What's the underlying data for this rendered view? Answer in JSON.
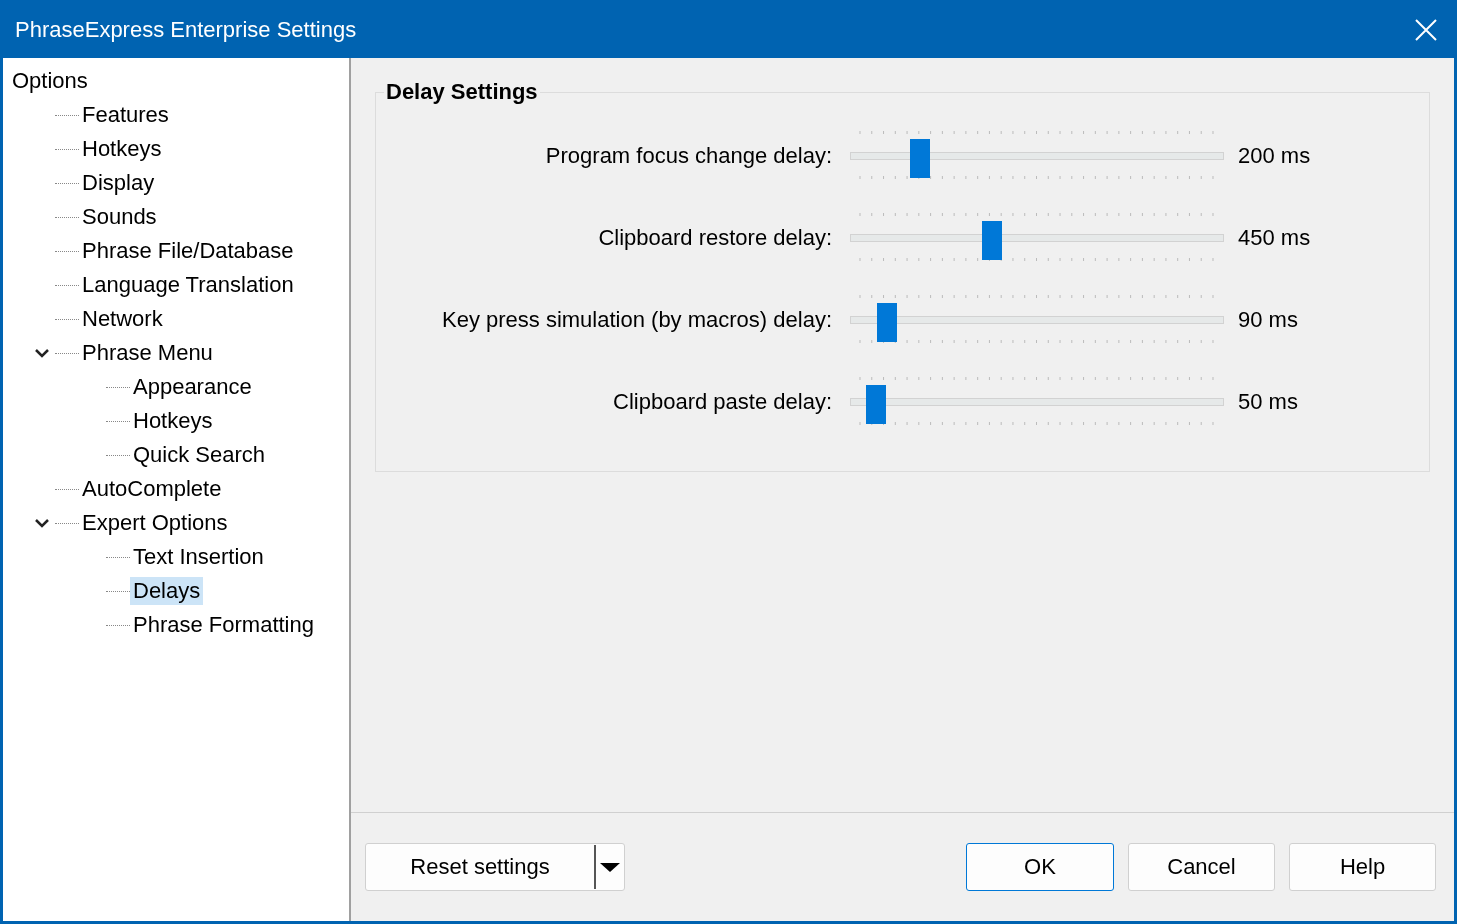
{
  "window": {
    "title": "PhraseExpress Enterprise Settings"
  },
  "tree": {
    "label": "Options",
    "children": [
      {
        "label": "Features",
        "selected": false
      },
      {
        "label": "Hotkeys",
        "selected": false
      },
      {
        "label": "Display",
        "selected": false
      },
      {
        "label": "Sounds",
        "selected": false
      },
      {
        "label": "Phrase File/Database",
        "selected": false
      },
      {
        "label": "Language Translation",
        "selected": false
      },
      {
        "label": "Network",
        "selected": false
      },
      {
        "label": "Phrase Menu",
        "selected": false,
        "expanded": true,
        "children": [
          {
            "label": "Appearance",
            "selected": false
          },
          {
            "label": "Hotkeys",
            "selected": false
          },
          {
            "label": "Quick Search",
            "selected": false
          }
        ]
      },
      {
        "label": "AutoComplete",
        "selected": false
      },
      {
        "label": "Expert Options",
        "selected": false,
        "expanded": true,
        "children": [
          {
            "label": "Text Insertion",
            "selected": false
          },
          {
            "label": "Delays",
            "selected": true
          },
          {
            "label": "Phrase Formatting",
            "selected": false
          }
        ]
      }
    ]
  },
  "group": {
    "title": "Delay Settings",
    "sliders": [
      {
        "label": "Program focus change delay:",
        "level": 0.167,
        "reading": "200 ms"
      },
      {
        "label": "Clipboard restore delay:",
        "level": 0.374,
        "reading": "450 ms"
      },
      {
        "label": "Key press simulation (by macros) delay:",
        "level": 0.074,
        "reading": "90 ms"
      },
      {
        "label": "Clipboard paste delay:",
        "level": 0.042,
        "reading": "50 ms"
      }
    ]
  },
  "buttons": {
    "reset": "Reset settings",
    "ok": "OK",
    "cancel": "Cancel",
    "help": "Help"
  }
}
